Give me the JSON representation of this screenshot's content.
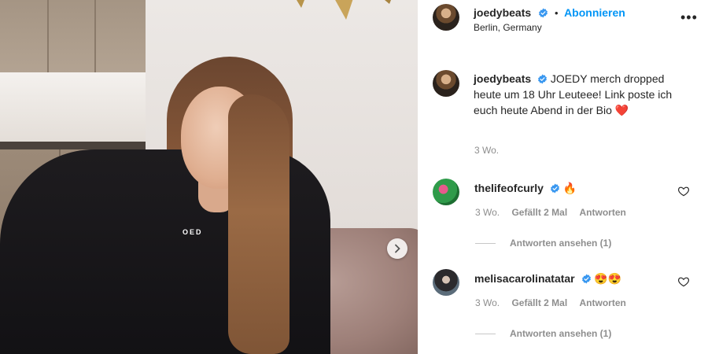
{
  "post": {
    "image_alt": "Photo of a young woman with long brown hair in a black hoodie",
    "hoodie_text": "OED"
  },
  "header": {
    "username": "joedybeats",
    "dot": "•",
    "follow_label": "Abonnieren",
    "location": "Berlin, Germany",
    "more_icon": "more-horizontal-icon"
  },
  "caption": {
    "username": "joedybeats",
    "text": "JOEDY merch dropped heute um 18 Uhr Leuteee! Link poste ich euch heute Abend in der Bio",
    "emoji": "❤️",
    "age": "3 Wo."
  },
  "comments": [
    {
      "username": "thelifeofcurly",
      "text": "🔥",
      "age": "3 Wo.",
      "likes": "Gefällt 2 Mal",
      "reply_label": "Antworten",
      "view_replies": "Antworten ansehen (1)"
    },
    {
      "username": "melisacarolinatatar",
      "text": "😍😍",
      "age": "3 Wo.",
      "likes": "Gefällt 2 Mal",
      "reply_label": "Antworten",
      "view_replies": "Antworten ansehen (1)"
    }
  ],
  "colors": {
    "accent": "#0095f6",
    "verified": "#3897f0",
    "text": "#262626",
    "muted": "#8e8e8e"
  }
}
